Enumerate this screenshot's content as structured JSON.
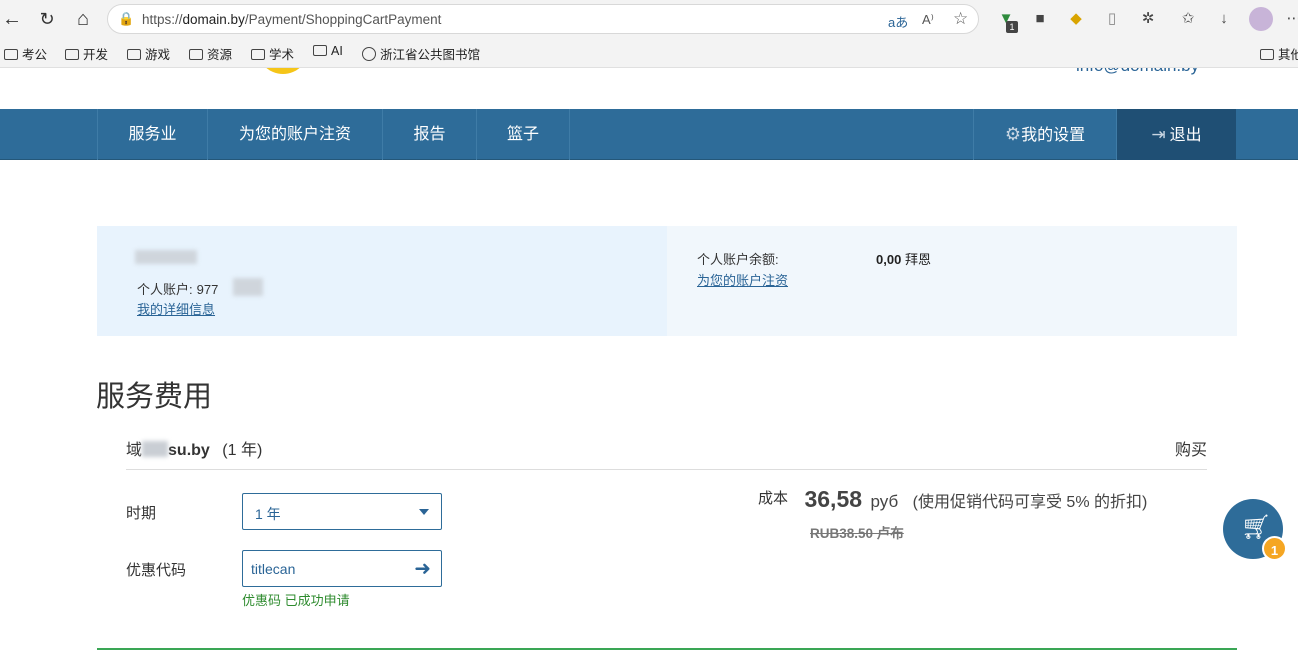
{
  "browser": {
    "url_prefix": "https://",
    "url_domain": "domain.by",
    "url_path": "/Payment/ShoppingCartPayment",
    "ext_badge": "1",
    "bookmarks": [
      "考公",
      "开发",
      "游戏",
      "资源",
      "学术",
      "AI",
      "浙江省公共图书馆",
      "其他"
    ]
  },
  "header": {
    "email": "info@domain.by"
  },
  "nav": {
    "items": [
      "服务业",
      "为您的账户注资",
      "报告",
      "篮子"
    ],
    "settings": "我的设置",
    "logout": "退出"
  },
  "account": {
    "account_label": "个人账户:",
    "account_number": "977",
    "details_link": "我的详细信息",
    "balance_label": "个人账户余额:",
    "balance_value": "0,00",
    "balance_currency": "拜恩",
    "topup_link": "为您的账户注资"
  },
  "section": {
    "title": "服务费用"
  },
  "service": {
    "domain_prefix": "域",
    "domain_name": "su.by",
    "term": "(1 年)",
    "buy": "购买"
  },
  "form": {
    "period_label": "时期",
    "period_value": "1 年",
    "promo_label": "优惠代码",
    "promo_value": "titlecan",
    "promo_success": "优惠码 已成功申请"
  },
  "price": {
    "cost_label": "成本",
    "amount": "36,58",
    "currency": "руб",
    "discount_note": "(使用促销代码可享受 5% 的折扣)",
    "old_price": "RUB38.50 卢布"
  },
  "cart": {
    "count": "1"
  },
  "colors": {
    "nav": "#2e6c99",
    "accent": "#f5a623",
    "success": "#3aa655"
  }
}
